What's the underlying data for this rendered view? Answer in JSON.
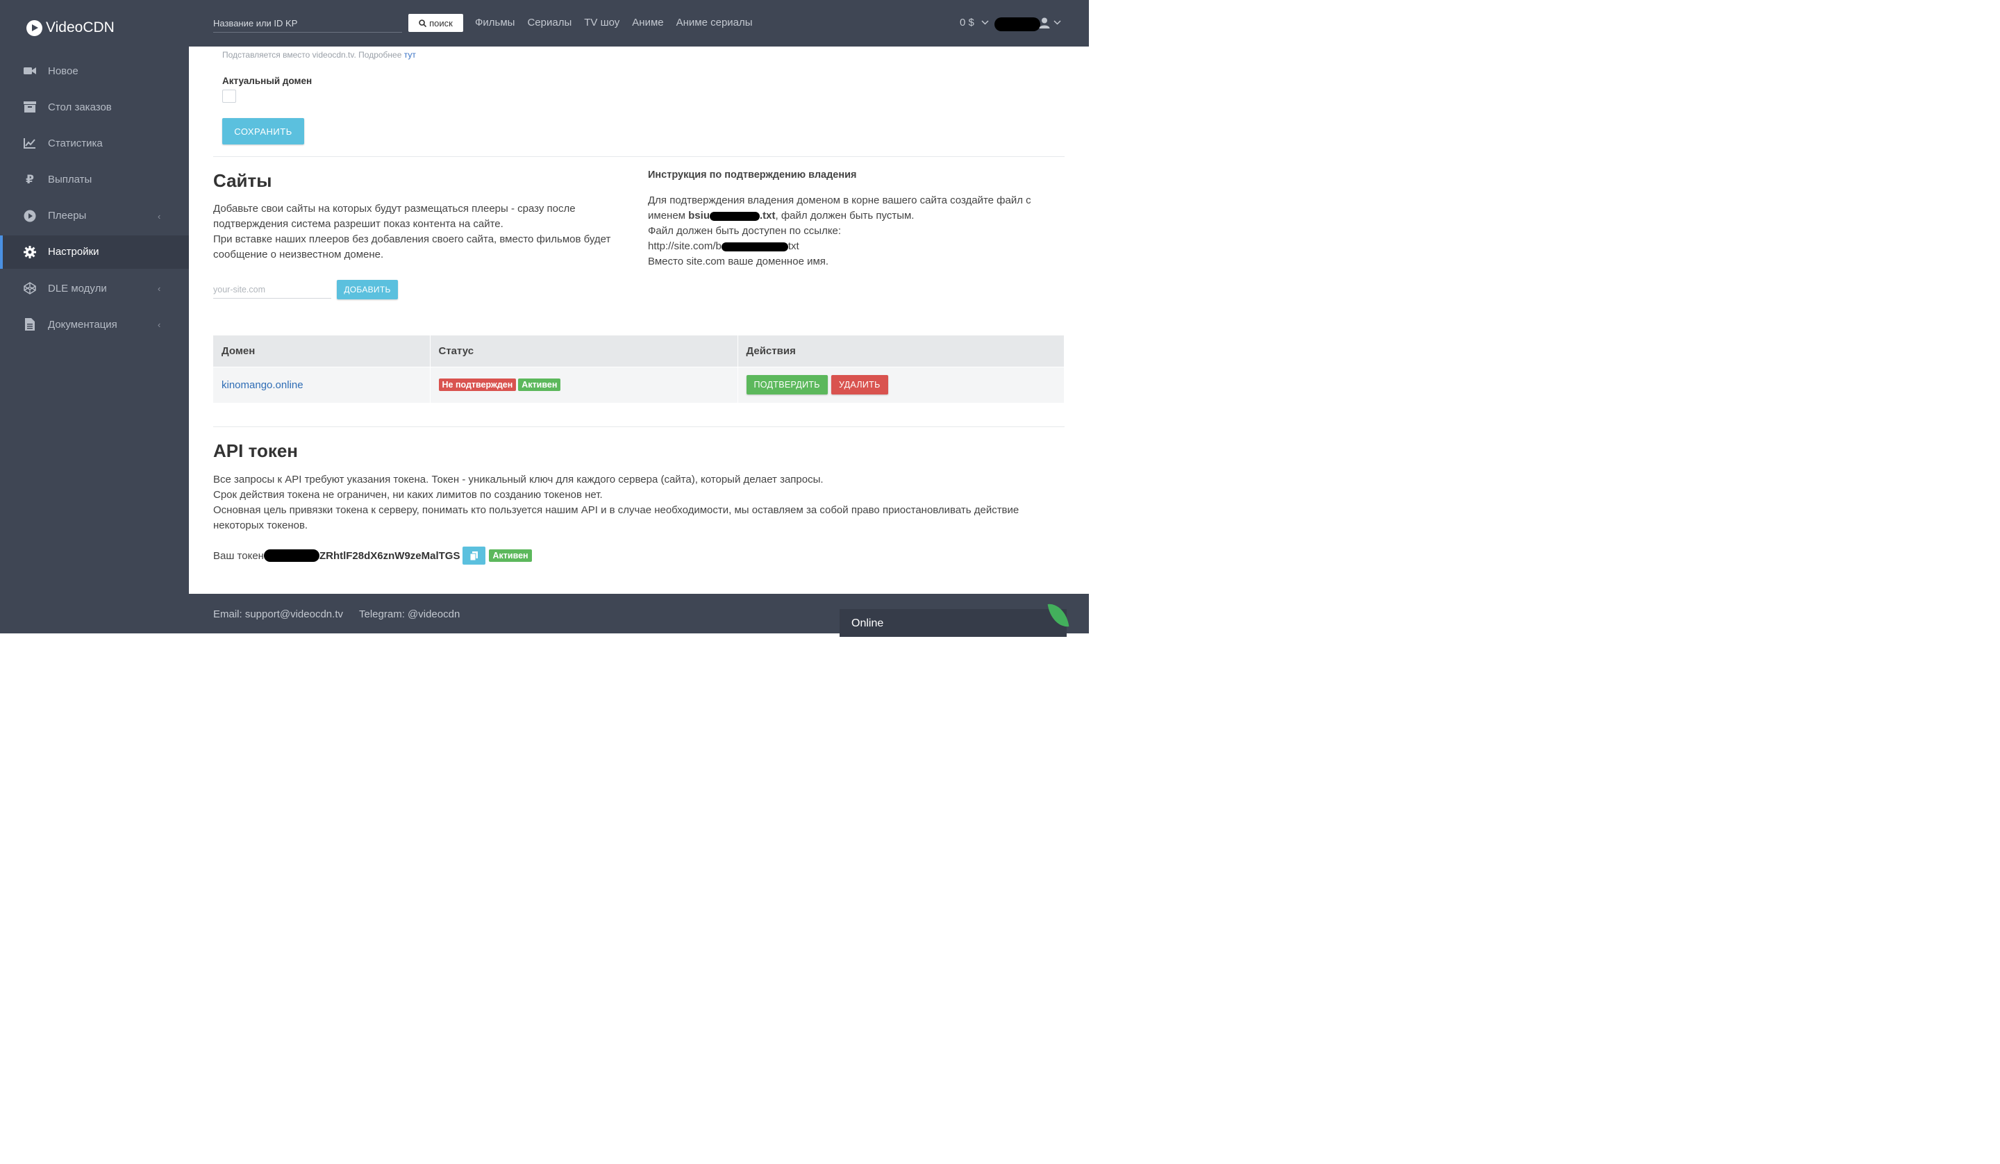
{
  "sidebar": {
    "logo": "VideoCDN",
    "items": [
      {
        "label": "Новое",
        "icon": "video-camera-icon"
      },
      {
        "label": "Стол заказов",
        "icon": "archive-box-icon"
      },
      {
        "label": "Статистика",
        "icon": "line-chart-icon"
      },
      {
        "label": "Выплаты",
        "icon": "ruble-icon"
      },
      {
        "label": "Плееры",
        "icon": "play-circle-icon",
        "chevron": "‹"
      },
      {
        "label": "Настройки",
        "icon": "gear-icon",
        "active": true
      },
      {
        "label": "DLE модули",
        "icon": "codepen-icon",
        "chevron": "‹"
      },
      {
        "label": "Документация",
        "icon": "document-icon",
        "chevron": "‹"
      }
    ]
  },
  "header": {
    "search_placeholder": "Название или ID KP",
    "search_button": "поиск",
    "nav": [
      "Фильмы",
      "Сериалы",
      "TV шоу",
      "Аниме",
      "Аниме сериалы"
    ],
    "balance": "0 $"
  },
  "settings": {
    "hint_text": "Подставляется вместо videocdn.tv. Подробнее ",
    "hint_link": "тут",
    "actual_domain_label": "Актуальный домен",
    "save_button": "СОХРАНИТЬ"
  },
  "sites": {
    "title": "Сайты",
    "desc_1": "Добавьте свои сайты на которых будут размещаться плееры - сразу после подтверждения система разрешит показ контента на сайте.",
    "desc_2": "При вставке наших плееров без добавления своего сайта, вместо фильмов будет сообщение о неизвестном домене.",
    "input_placeholder": "your-site.com",
    "add_button": "ДОБАВИТЬ"
  },
  "instructions": {
    "title": "Инструкция по подтверждению владения",
    "line1_a": "Для подтверждения владения доменом в корне вашего сайта создайте файл с именем ",
    "file_prefix": "bsiu",
    "file_suffix": ".txt",
    "line1_b": ", файл должен быть пустым.",
    "line2": "Файл должен быть доступен по ссылке:",
    "url_prefix": "http://site.com/b",
    "url_suffix": "txt",
    "line4": "Вместо site.com ваше доменное имя."
  },
  "table": {
    "headers": [
      "Домен",
      "Статус",
      "Действия"
    ],
    "rows": [
      {
        "domain": "kinomango.online",
        "status_1": "Не подтвержден",
        "status_2": "Активен",
        "action_confirm": "ПОДТВЕРДИТЬ",
        "action_delete": "УДАЛИТЬ"
      }
    ]
  },
  "api": {
    "title": "API токен",
    "desc_1": "Все запросы к API требуют указания токена. Токен - уникальный ключ для каждого сервера (сайта), который делает запросы.",
    "desc_2": "Срок действия токена не ограничен, ни каких лимитов по созданию токенов нет.",
    "desc_3": "Основная цель привязки токена к серверу, понимать кто пользуется нашим API и в случае необходимости, мы оставляем за собой право приостановливать действие некоторых токенов.",
    "token_label": "Ваш токен",
    "token_visible": "ZRhtlF28dX6znW9zeMalTGS",
    "token_status": "Активен"
  },
  "footer": {
    "email": "Email: support@videocdn.tv",
    "telegram": "Telegram:  @videocdn",
    "online": "Online"
  },
  "colors": {
    "sidebar_bg": "#3f4654",
    "accent_blue": "#5bc0de",
    "success": "#5cb85c",
    "danger": "#d9534f",
    "active_bar": "#4a90e2"
  }
}
